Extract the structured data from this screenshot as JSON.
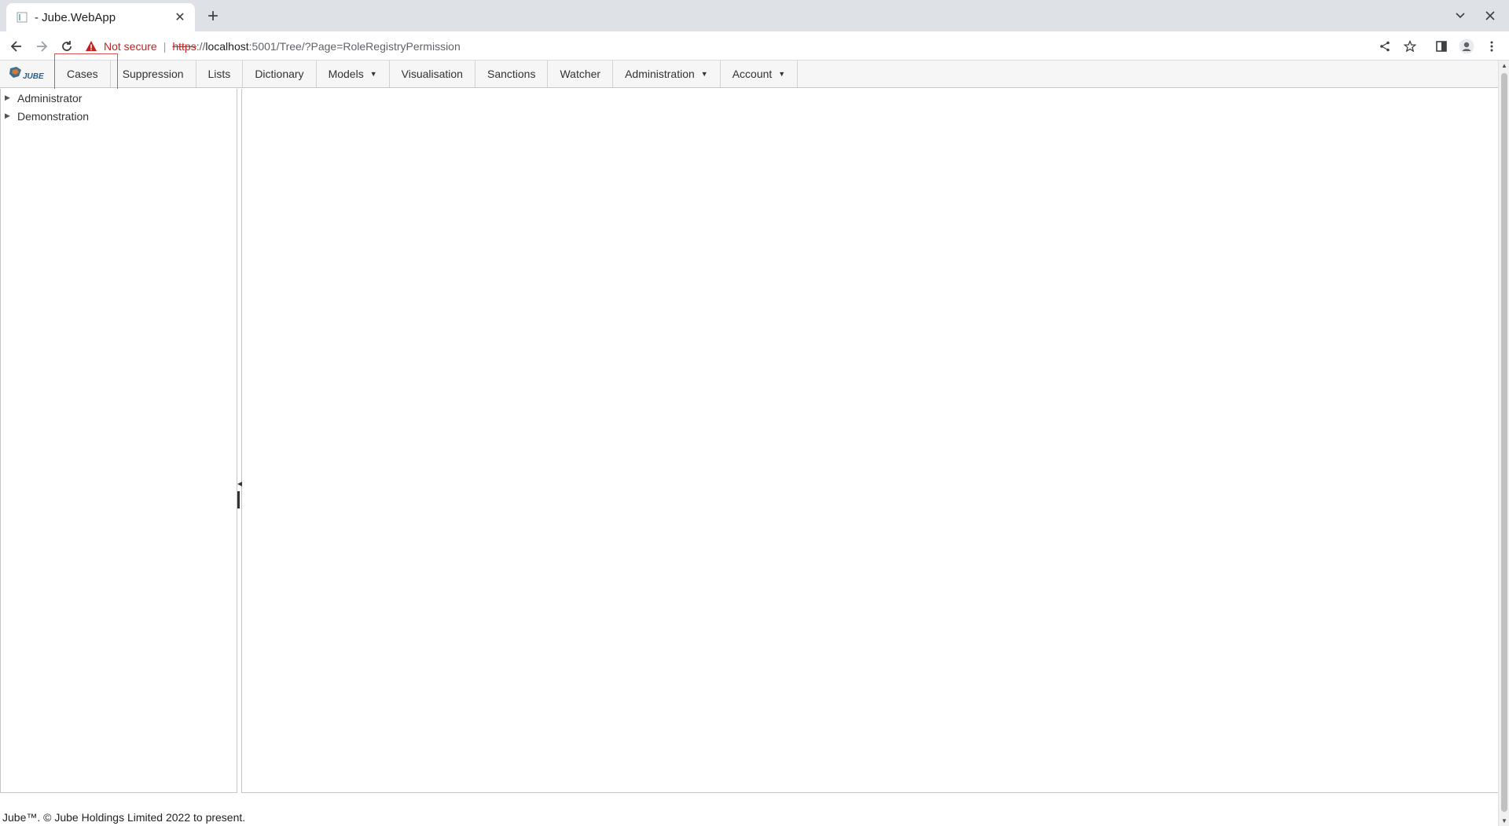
{
  "browser": {
    "tab_title": "- Jube.WebApp",
    "new_tab_label": "+",
    "close_tab_label": "✕",
    "not_secure_label": "Not secure",
    "separator": "|",
    "url": {
      "scheme": "https",
      "sep": "://",
      "host": "localhost",
      "rest": ":5001/Tree/?Page=RoleRegistryPermission"
    }
  },
  "menubar": {
    "items": [
      {
        "label": "Cases"
      },
      {
        "label": "Suppression"
      },
      {
        "label": "Lists"
      },
      {
        "label": "Dictionary"
      },
      {
        "label": "Models"
      },
      {
        "label": "Visualisation"
      },
      {
        "label": "Sanctions"
      },
      {
        "label": "Watcher"
      },
      {
        "label": "Administration"
      },
      {
        "label": "Account"
      }
    ],
    "logo_text": "JUBE"
  },
  "tree": {
    "nodes": [
      {
        "label": "Administrator"
      },
      {
        "label": "Demonstration"
      }
    ]
  },
  "footer": {
    "text": "Jube™. © Jube Holdings Limited 2022 to present."
  },
  "colors": {
    "highlight_box": "#e05252",
    "not_secure": "#c5221f",
    "menubar_bg": "#f6f6f6"
  }
}
